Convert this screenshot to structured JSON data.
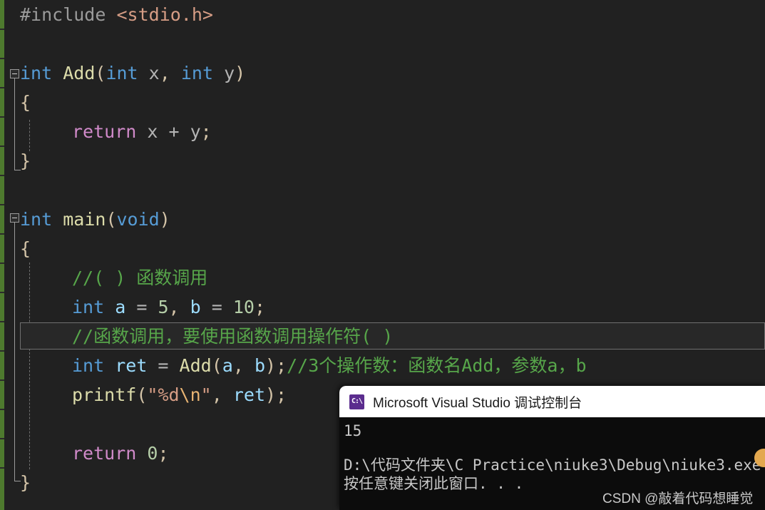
{
  "editor": {
    "background": "#212121",
    "change_bar_color": "#4e7a2e",
    "current_line_index": 12,
    "lines": [
      {
        "n": 0,
        "indent": 0,
        "text": "#include <stdio.h>"
      },
      {
        "n": 1,
        "indent": 0,
        "text": ""
      },
      {
        "n": 2,
        "indent": 0,
        "text": "int Add(int x, int y)"
      },
      {
        "n": 3,
        "indent": 0,
        "text": "{"
      },
      {
        "n": 4,
        "indent": 1,
        "text": "return x + y;"
      },
      {
        "n": 5,
        "indent": 0,
        "text": "}"
      },
      {
        "n": 6,
        "indent": 0,
        "text": ""
      },
      {
        "n": 7,
        "indent": 0,
        "text": "int main(void)"
      },
      {
        "n": 8,
        "indent": 0,
        "text": "{"
      },
      {
        "n": 9,
        "indent": 1,
        "text": "//( ) 函数调用"
      },
      {
        "n": 10,
        "indent": 1,
        "text": "int a = 5, b = 10;"
      },
      {
        "n": 11,
        "indent": 1,
        "text": "//函数调用，要使用函数调用操作符( )"
      },
      {
        "n": 12,
        "indent": 1,
        "text": "int ret = Add(a, b);//3个操作数：函数名Add，参数a，b"
      },
      {
        "n": 13,
        "indent": 1,
        "text": "printf(\"%d\\n\", ret);"
      },
      {
        "n": 14,
        "indent": 1,
        "text": ""
      },
      {
        "n": 15,
        "indent": 1,
        "text": "return 0;"
      },
      {
        "n": 16,
        "indent": 0,
        "text": "}"
      }
    ],
    "tokens": {
      "include_directive": "#include",
      "include_header": "<stdio.h>",
      "keyword_int": "int",
      "fn_add": "Add",
      "fn_printf": "printf",
      "fn_main": "main",
      "keyword_void": "void",
      "keyword_return": "return",
      "var_x": "x",
      "var_y": "y",
      "var_a": "a",
      "var_b": "b",
      "var_ret": "ret",
      "num_5": "5",
      "num_10": "10",
      "num_0": "0",
      "open_brace": "{",
      "close_brace": "}",
      "comment_1": "//( ) 函数调用",
      "comment_2": "//函数调用，要使用函数调用操作符( )",
      "comment_3": "//3个操作数：函数名Add，参数a，b",
      "printf_string": "\"%d\\n\"",
      "printf_fmt": "%d",
      "printf_escape": "\\n"
    },
    "colors": {
      "keyword": "#569cd6",
      "function": "#dcdcaa",
      "variable": "#9cdcfe",
      "comment": "#57a64a",
      "string": "#d69d85",
      "number": "#b5cea8",
      "control": "#d08ac9",
      "plain": "#b4b4b4"
    },
    "fold_markers": [
      {
        "name": "fold-add-function",
        "collapsed": false
      },
      {
        "name": "fold-main-function",
        "collapsed": false
      }
    ]
  },
  "console": {
    "icon": "console-window-icon",
    "icon_glyph": "C:\\",
    "title": "Microsoft Visual Studio 调试控制台",
    "output_lines": [
      "15",
      "",
      "D:\\代码文件夹\\C Practice\\niuke3\\Debug\\niuke3.exe",
      "按任意键关闭此窗口. . ."
    ]
  },
  "watermark": {
    "text": "CSDN @敲着代码想睡觉"
  }
}
